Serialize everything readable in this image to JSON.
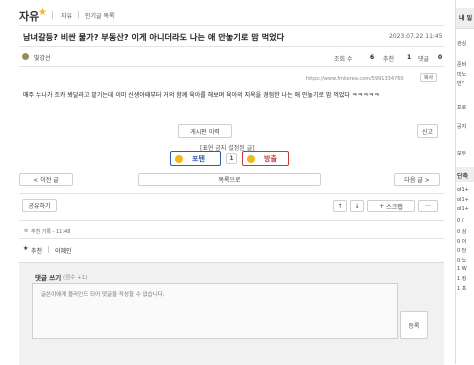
{
  "board": {
    "name": "자유",
    "crumbs": [
      "자유",
      "인기글 목록"
    ]
  },
  "post": {
    "title": "남녀갈등? 비싼 물가? 부동산? 이게 아니더라도 나는 애 안놓기로 맘 먹었다",
    "datetime": "2023.07.22 11:45",
    "author": "빛강선",
    "views_label": "조회 수",
    "views": "6",
    "recommend_label": "추천",
    "recommend": "1",
    "comments_label": "댓글",
    "comments": "0",
    "url": "https://www.fmkorea.com/5991334760",
    "copy_label": "복사",
    "body": "매주 누나가 조카 봐달라고 맡기는데 이미 신생아때부터 거의 함께 육아를 해보며 육아의 지옥을 경험한 나는 애 안놓기로 맘 먹었다 ㅋㅋㅋㅋㅋ"
  },
  "actions": {
    "history_label": "게시판 이력",
    "report_label": "신고",
    "expression_notice": "[표현 금지 설정된 글]",
    "potent_label": "포텐",
    "vote_count": "1",
    "bang_label": "방출",
    "prev_label": "< 이전 글",
    "list_label": "목록으로",
    "next_label": "다음 글 >",
    "share_label": "공유하기",
    "scrap_label": "스크랩"
  },
  "rec_log": {
    "header": "추천 기록 - 11:48",
    "type": "추천",
    "user": "이혜인"
  },
  "comment_form": {
    "title": "댓글 쓰기",
    "points": "(점수 +1)",
    "placeholder": "글쓴이에게 블라인드 되어 댓글을 작성할 수 없습니다.",
    "submit_label": "등록"
  },
  "sidebar": {
    "header": "내 일",
    "lines": [
      "관심",
      "준비",
      "미노",
      "반\"",
      "프로",
      "공지",
      "모두",
      "단축"
    ],
    "rows": [
      "ol1+",
      "ol1+",
      "ol1+",
      "0 /",
      "0 상",
      "0 이",
      "0 당",
      "0 노",
      "1 W",
      "1 킹",
      "1 프"
    ]
  },
  "colors": {
    "accent_red": "#c23a3a",
    "accent_blue": "#2b5cb8",
    "star": "#f2b71a"
  }
}
